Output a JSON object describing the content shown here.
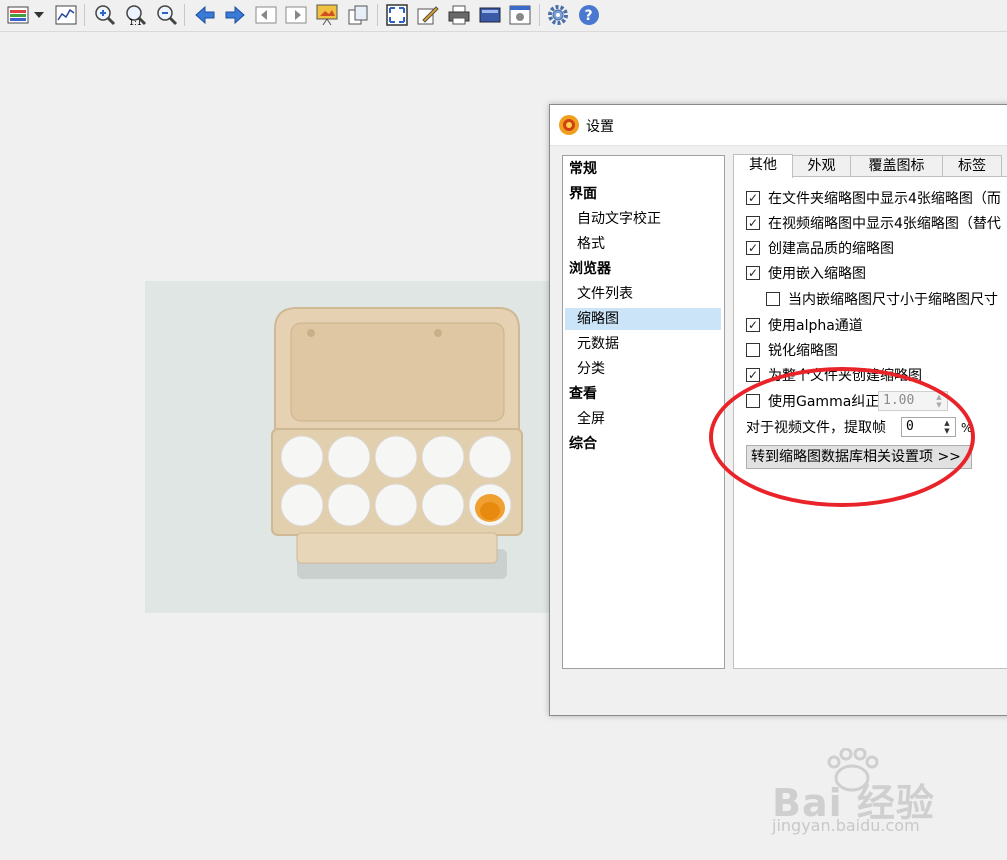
{
  "toolbar": {
    "icons": [
      "color-tools-icon",
      "dropdown-arrow-icon",
      "histogram-icon",
      "zoom-in-icon",
      "zoom-actual-icon",
      "zoom-out-icon",
      "arrow-left-icon",
      "arrow-right-icon",
      "page-prev-icon",
      "page-next-icon",
      "slideshow-icon",
      "fit-icon",
      "fullscreen-icon",
      "edit-icon",
      "print-icon",
      "scanner-icon",
      "capture-icon",
      "settings-gear-icon",
      "help-icon"
    ]
  },
  "dialog": {
    "title": "设置",
    "tree": [
      {
        "label": "常规",
        "type": "cat"
      },
      {
        "label": "界面",
        "type": "cat"
      },
      {
        "label": "自动文字校正",
        "type": "sub"
      },
      {
        "label": "格式",
        "type": "sub"
      },
      {
        "label": "浏览器",
        "type": "cat"
      },
      {
        "label": "文件列表",
        "type": "sub"
      },
      {
        "label": "缩略图",
        "type": "sub",
        "selected": true
      },
      {
        "label": "元数据",
        "type": "sub"
      },
      {
        "label": "分类",
        "type": "sub"
      },
      {
        "label": "查看",
        "type": "cat"
      },
      {
        "label": "全屏",
        "type": "sub"
      },
      {
        "label": "综合",
        "type": "cat"
      }
    ],
    "tabs": [
      "其他",
      "外观",
      "覆盖图标",
      "标签"
    ],
    "active_tab": "其他",
    "options": [
      {
        "label": "在文件夹缩略图中显示4张缩略图（而",
        "checked": true
      },
      {
        "label": "在视频缩略图中显示4张缩略图（替代",
        "checked": true
      },
      {
        "label": "创建高品质的缩略图",
        "checked": true
      },
      {
        "label": "使用嵌入缩略图",
        "checked": true
      },
      {
        "label": "当内嵌缩略图尺寸小于缩略图尺寸",
        "checked": false,
        "indent": true
      },
      {
        "label": "使用alpha通道",
        "checked": true
      },
      {
        "label": "锐化缩略图",
        "checked": false
      },
      {
        "label": "为整个文件夹创建缩略图",
        "checked": true
      },
      {
        "label": "使用Gamma纠正",
        "checked": false
      }
    ],
    "gamma_value": "1.00",
    "video_frame_label": "对于视频文件，提取帧",
    "video_frame_value": "0",
    "video_frame_unit": "%",
    "db_button": "转到缩略图数据库相关设置项 >>"
  },
  "watermark": {
    "brand": "Bai 经验",
    "sub": "jingyan.baidu.com"
  },
  "colors": {
    "selection": "#cce4f7",
    "annotation": "#e8232a",
    "accent_blue": "#2f6fce"
  }
}
